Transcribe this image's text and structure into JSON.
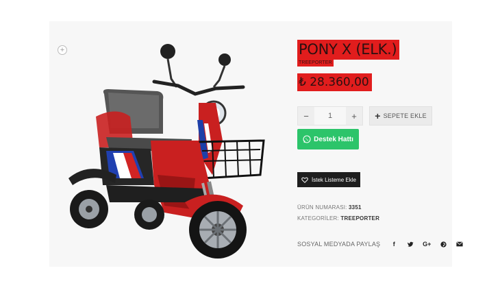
{
  "product": {
    "title": "PONY X (ELK.)",
    "brand": "TREEPORTER",
    "price": "₺ 28.360,00"
  },
  "quantity": {
    "minus": "−",
    "value": "1",
    "plus": "+"
  },
  "buttons": {
    "add_to_cart": "SEPETE EKLE",
    "whatsapp": "Destek Hattı",
    "wishlist": "İstek Listeme Ekle"
  },
  "meta": {
    "sku_label": "ÜRÜN NUMARASI:",
    "sku_value": "3351",
    "category_label": "KATEGORİLER:",
    "category_value": "TREEPORTER"
  },
  "share": {
    "label": "SOSYAL MEDYADA PAYLAŞ",
    "icons": [
      "facebook-icon",
      "twitter-icon",
      "google-plus-icon",
      "pinterest-icon",
      "email-icon"
    ]
  },
  "colors": {
    "highlight": "#e11d1d",
    "whatsapp": "#2cc46a",
    "wishlist_bg": "#1e1e1e"
  }
}
